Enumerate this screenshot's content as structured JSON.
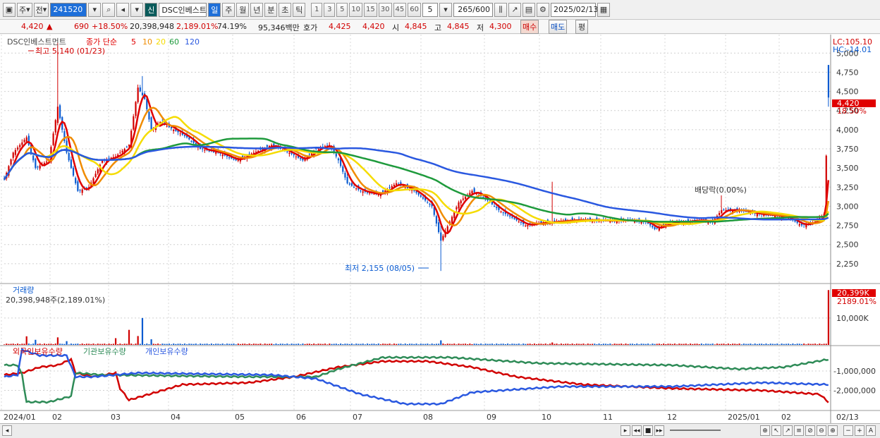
{
  "toolbar": {
    "period_sel": "주",
    "prev_label": "전",
    "code": "241520",
    "new_badge": "신",
    "stock_name": "DSC인베스트",
    "periods": [
      "일",
      "주",
      "월",
      "년",
      "분",
      "초",
      "틱"
    ],
    "intervals": [
      "1",
      "3",
      "5",
      "10",
      "15",
      "30",
      "45",
      "60"
    ],
    "interval_value": "5",
    "count": "265",
    "count_total": "/600",
    "date": "2025/02/13"
  },
  "quote": {
    "price": "4,420",
    "arrow": "▲",
    "change": "690",
    "rate": "+18.50%",
    "volume": "20,398,948",
    "vol_rate": "2,189.01%",
    "turnover": "74.19%",
    "amount": "95,346백만",
    "bid_label": "호가",
    "bid1": "4,425",
    "bid2": "4,420",
    "open_label": "시",
    "open": "4,845",
    "high_label": "고",
    "high": "4,845",
    "low_label": "저",
    "low": "4,300",
    "buy": "매수",
    "sell": "매도",
    "avg": "평"
  },
  "colors": {
    "up": "#d10000",
    "down": "#0a5bd1",
    "ma5": "#e00000",
    "ma10": "#f08c00",
    "ma20": "#f5dc00",
    "ma60": "#1e9a3c",
    "ma120": "#2a58e0",
    "foreign": "#d10000",
    "inst": "#2e8b57",
    "indiv": "#2a58e0"
  },
  "chart_data": {
    "type": "candlestick",
    "title": "DSC인베스트먼트",
    "ma_label": "종가 단순",
    "ma_periods": [
      "5",
      "10",
      "20",
      "60",
      "120"
    ],
    "y_ticks": [
      "5,000",
      "4,750",
      "4,500",
      "4,250",
      "4,000",
      "3,750",
      "3,500",
      "3,250",
      "3,000",
      "2,750",
      "2,500",
      "2,250"
    ],
    "ylim": [
      2000,
      5150
    ],
    "x_ticks": [
      "2024/01",
      "02",
      "03",
      "04",
      "05",
      "06",
      "07",
      "08",
      "09",
      "10",
      "11",
      "12",
      "2025/01",
      "02"
    ],
    "right_labels": {
      "lc": "LC:105.10",
      "hc": "HC:-14.01",
      "price": "4,420",
      "rate": "18.50%"
    },
    "annotations": {
      "high": "최고 5,140 (01/23)",
      "low": "최저 2,155 (08/05)",
      "dividend": "배당락(0.00%)"
    },
    "close_path": [
      [
        0,
        3350
      ],
      [
        4,
        3700
      ],
      [
        10,
        3900
      ],
      [
        14,
        3500
      ],
      [
        20,
        3600
      ],
      [
        24,
        4300
      ],
      [
        28,
        3700
      ],
      [
        33,
        3200
      ],
      [
        38,
        3250
      ],
      [
        44,
        3600
      ],
      [
        50,
        3650
      ],
      [
        56,
        3800
      ],
      [
        60,
        4550
      ],
      [
        63,
        4400
      ],
      [
        66,
        4000
      ],
      [
        70,
        4100
      ],
      [
        76,
        4000
      ],
      [
        82,
        3900
      ],
      [
        88,
        3750
      ],
      [
        96,
        3700
      ],
      [
        104,
        3600
      ],
      [
        112,
        3700
      ],
      [
        120,
        3800
      ],
      [
        128,
        3700
      ],
      [
        134,
        3600
      ],
      [
        140,
        3750
      ],
      [
        146,
        3800
      ],
      [
        150,
        3600
      ],
      [
        154,
        3300
      ],
      [
        160,
        3200
      ],
      [
        168,
        3150
      ],
      [
        176,
        3300
      ],
      [
        184,
        3200
      ],
      [
        192,
        3000
      ],
      [
        196,
        2550
      ],
      [
        200,
        2800
      ],
      [
        204,
        3050
      ],
      [
        210,
        3200
      ],
      [
        216,
        3100
      ],
      [
        222,
        2950
      ],
      [
        228,
        2850
      ],
      [
        234,
        2750
      ],
      [
        240,
        2780
      ],
      [
        248,
        2800
      ],
      [
        256,
        2820
      ],
      [
        264,
        2820
      ],
      [
        272,
        2810
      ],
      [
        280,
        2820
      ],
      [
        288,
        2800
      ],
      [
        292,
        2700
      ],
      [
        298,
        2780
      ],
      [
        306,
        2800
      ],
      [
        312,
        2820
      ],
      [
        318,
        2800
      ],
      [
        322,
        2950
      ],
      [
        330,
        2950
      ],
      [
        338,
        2900
      ],
      [
        346,
        2880
      ],
      [
        352,
        2850
      ],
      [
        358,
        2750
      ],
      [
        364,
        2800
      ],
      [
        368,
        2900
      ],
      [
        370,
        4420
      ]
    ],
    "highs": [
      [
        24,
        5140
      ],
      [
        62,
        4700
      ],
      [
        196,
        2800
      ],
      [
        246,
        3320
      ],
      [
        370,
        4845
      ]
    ],
    "lows": [
      [
        196,
        2155
      ],
      [
        370,
        4300
      ]
    ],
    "ma_offsets": [
      0,
      -60,
      -120,
      -200,
      -300
    ],
    "volume": {
      "label": "거래량",
      "value_text": "20,398,948주(2,189.01%)",
      "tick": "10,000K",
      "right_labels": {
        "value": "20,399K",
        "rate": "2189.01%"
      },
      "max": 21000000,
      "spikes": [
        [
          10,
          3200000
        ],
        [
          14,
          1900000
        ],
        [
          24,
          2800000
        ],
        [
          28,
          1400000
        ],
        [
          50,
          2500000
        ],
        [
          56,
          5600000
        ],
        [
          60,
          3300000
        ],
        [
          62,
          10000000
        ],
        [
          66,
          2100000
        ],
        [
          196,
          1700000
        ],
        [
          246,
          900000
        ],
        [
          370,
          20398948
        ]
      ],
      "baseline": 300000
    },
    "holdings": {
      "labels": [
        "외국인보유수량",
        "기관보유수량",
        "개인보유수량"
      ],
      "ticks": [
        "-1,000,000",
        "-2,000,000"
      ],
      "ylim": [
        -3000000,
        200000
      ],
      "foreign": [
        [
          0,
          -1200000
        ],
        [
          8,
          -1100000
        ],
        [
          16,
          -800000
        ],
        [
          24,
          -700000
        ],
        [
          30,
          -400000
        ],
        [
          32,
          -1100000
        ],
        [
          40,
          -1300000
        ],
        [
          50,
          -1100000
        ],
        [
          52,
          -1900000
        ],
        [
          56,
          -2500000
        ],
        [
          62,
          -2300000
        ],
        [
          80,
          -1700000
        ],
        [
          110,
          -1600000
        ],
        [
          130,
          -1300000
        ],
        [
          150,
          -800000
        ],
        [
          170,
          -500000
        ],
        [
          190,
          -500000
        ],
        [
          210,
          -800000
        ],
        [
          230,
          -1300000
        ],
        [
          260,
          -1700000
        ],
        [
          300,
          -1900000
        ],
        [
          340,
          -2000000
        ],
        [
          366,
          -2200000
        ],
        [
          370,
          -2600000
        ]
      ],
      "institution": [
        [
          0,
          -700000
        ],
        [
          6,
          -700000
        ],
        [
          8,
          -1200000
        ],
        [
          10,
          -2600000
        ],
        [
          20,
          -2600000
        ],
        [
          30,
          -2300000
        ],
        [
          32,
          -1100000
        ],
        [
          44,
          -1200000
        ],
        [
          110,
          -1300000
        ],
        [
          140,
          -1300000
        ],
        [
          150,
          -900000
        ],
        [
          170,
          -300000
        ],
        [
          200,
          -300000
        ],
        [
          240,
          -600000
        ],
        [
          300,
          -700000
        ],
        [
          330,
          -900000
        ],
        [
          350,
          -800000
        ],
        [
          370,
          -400000
        ]
      ],
      "individual": [
        [
          0,
          -1300000
        ],
        [
          6,
          -1200000
        ],
        [
          8,
          100000
        ],
        [
          16,
          -200000
        ],
        [
          28,
          -200000
        ],
        [
          32,
          -1300000
        ],
        [
          40,
          -1300000
        ],
        [
          60,
          -1100000
        ],
        [
          120,
          -1200000
        ],
        [
          140,
          -1400000
        ],
        [
          160,
          -2200000
        ],
        [
          180,
          -2700000
        ],
        [
          196,
          -2700000
        ],
        [
          210,
          -2100000
        ],
        [
          250,
          -1800000
        ],
        [
          300,
          -1800000
        ],
        [
          320,
          -1700000
        ],
        [
          340,
          -1600000
        ],
        [
          370,
          -1700000
        ]
      ]
    }
  },
  "bottom": {
    "date": "02/13"
  }
}
